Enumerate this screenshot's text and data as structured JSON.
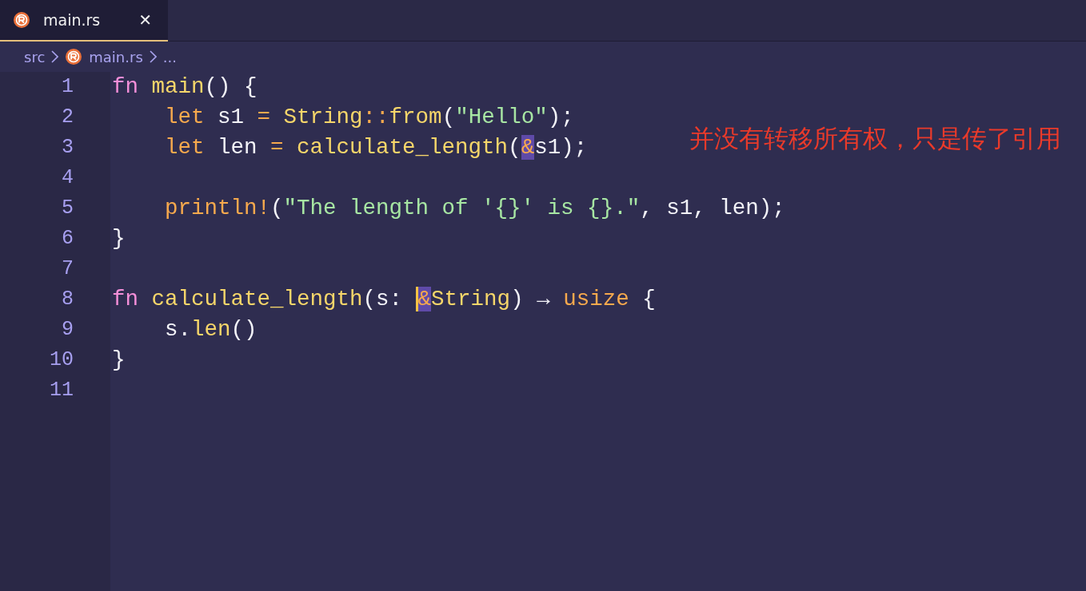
{
  "tabs": [
    {
      "label": "main.rs",
      "selected": true,
      "close": "✕"
    }
  ],
  "breadcrumb": [
    "src",
    "main.rs",
    "..."
  ],
  "editor": {
    "lines": [
      {
        "number": "1",
        "tokens": [
          {
            "t": "fn",
            "kind": "keyword"
          },
          {
            "t": " main",
            "kind": "function"
          },
          {
            "t": "() {",
            "kind": "plain"
          }
        ]
      },
      {
        "number": "2",
        "tokens": [
          {
            "t": "    let",
            "kind": "decl"
          },
          {
            "t": " s1 ",
            "kind": "plain"
          },
          {
            "t": "=",
            "kind": "operator"
          },
          {
            "t": " String",
            "kind": "type"
          },
          {
            "t": "::",
            "kind": "operator"
          },
          {
            "t": "from",
            "kind": "function"
          },
          {
            "t": "(",
            "kind": "plain"
          },
          {
            "t": "\"Hello\"",
            "kind": "string"
          },
          {
            "t": ");",
            "kind": "plain"
          }
        ]
      },
      {
        "number": "3",
        "tokens": [
          {
            "t": "    let",
            "kind": "decl"
          },
          {
            "t": " len ",
            "kind": "plain"
          },
          {
            "t": "=",
            "kind": "operator"
          },
          {
            "t": " calculate_length",
            "kind": "function"
          },
          {
            "t": "(",
            "kind": "plain"
          },
          {
            "t": "&",
            "kind": "operator",
            "highlighted": true
          },
          {
            "t": "s1);",
            "kind": "plain"
          }
        ]
      },
      {
        "number": "4"
      },
      {
        "number": "5",
        "tokens": [
          {
            "t": "    println!",
            "kind": "macro"
          },
          {
            "t": "(",
            "kind": "plain"
          },
          {
            "t": "\"The length of '{}' is {}.\"",
            "kind": "string"
          },
          {
            "t": ", s1, len);",
            "kind": "plain"
          }
        ]
      },
      {
        "number": "6",
        "tokens": [
          {
            "t": "}",
            "kind": "plain"
          }
        ]
      },
      {
        "number": "7"
      },
      {
        "number": "8",
        "tokens": [
          {
            "t": "fn",
            "kind": "keyword"
          },
          {
            "t": " calculate_length",
            "kind": "function"
          },
          {
            "t": "(s: ",
            "kind": "plain"
          },
          {
            "t": "&",
            "kind": "operator",
            "highlighted": true,
            "cursor": true
          },
          {
            "t": "String",
            "kind": "type"
          },
          {
            "t": ") → ",
            "kind": "plain"
          },
          {
            "t": "usize",
            "kind": "decl"
          },
          {
            "t": " {",
            "kind": "plain"
          }
        ]
      },
      {
        "number": "9",
        "tokens": [
          {
            "t": "    s.",
            "kind": "plain"
          },
          {
            "t": "len",
            "kind": "function"
          },
          {
            "t": "()",
            "kind": "plain"
          }
        ]
      },
      {
        "number": "10",
        "tokens": [
          {
            "t": "}",
            "kind": "plain"
          }
        ]
      },
      {
        "number": "11"
      }
    ]
  },
  "annotation": "并没有转移所有权，只是传了引用"
}
